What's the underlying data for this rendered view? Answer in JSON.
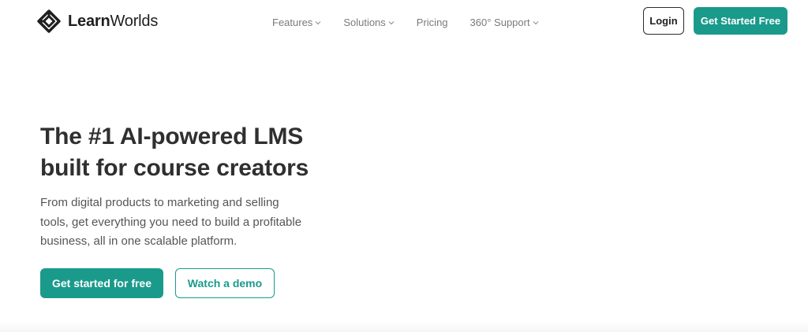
{
  "brand": {
    "name_strong": "Learn",
    "name_regular": "Worlds",
    "logo_icon": "learnworlds-diamond-logo-icon"
  },
  "nav": {
    "items": [
      {
        "label": "Features",
        "icon": "chevron-down-icon"
      },
      {
        "label": "Solutions",
        "icon": "chevron-down-icon"
      },
      {
        "label": "Pricing"
      },
      {
        "label": "360° Support",
        "icon": "chevron-down-icon"
      }
    ]
  },
  "header": {
    "login_label": "Login",
    "cta_label": "Get Started Free"
  },
  "hero": {
    "title_line1": "The #1 AI-powered LMS",
    "title_line2": "built for course creators",
    "subtitle_line1": "From digital products to marketing and selling",
    "subtitle_line2": "tools, get everything you need to build a profitable",
    "subtitle_line3": "business, all in one scalable platform.",
    "primary_cta": "Get started for free",
    "secondary_cta": "Watch a demo"
  },
  "colors": {
    "accent": "#1a9a8b",
    "text_dark": "#2f2f2f",
    "text_muted": "#7a7a7a"
  }
}
